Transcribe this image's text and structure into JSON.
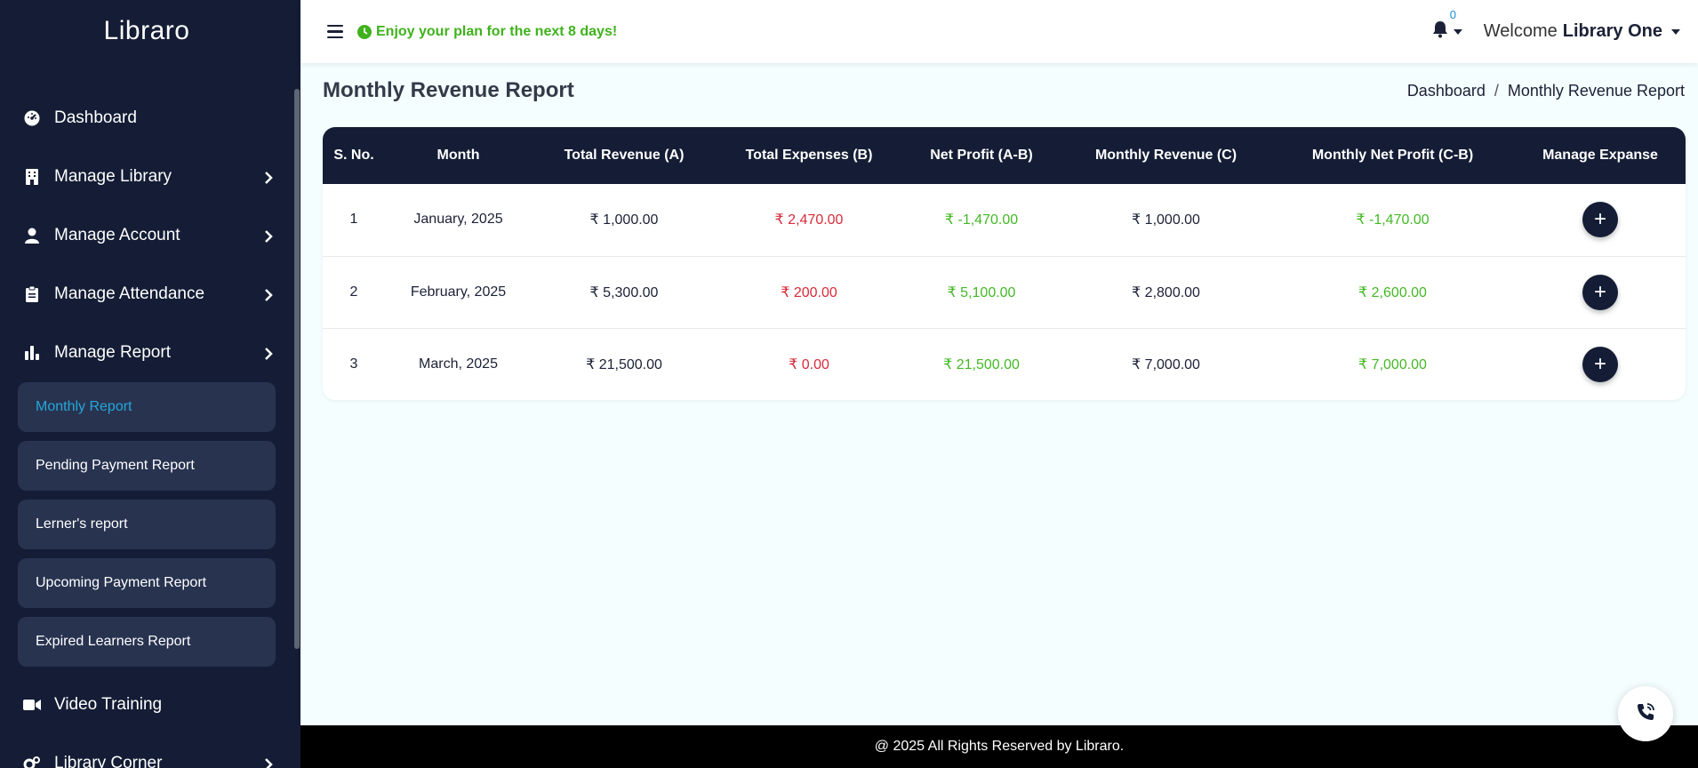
{
  "brand": "Libraro",
  "sidebar": {
    "items": [
      {
        "label": "Dashboard",
        "icon": "dashboard-icon"
      },
      {
        "label": "Manage Library",
        "icon": "building-icon"
      },
      {
        "label": "Manage Account",
        "icon": "user-icon"
      },
      {
        "label": "Manage Attendance",
        "icon": "clipboard-icon"
      },
      {
        "label": "Manage Report",
        "icon": "bar-chart-icon"
      }
    ],
    "sub_items": [
      {
        "label": "Monthly Report",
        "active": true
      },
      {
        "label": "Pending Payment Report"
      },
      {
        "label": "Lerner's report"
      },
      {
        "label": "Upcoming Payment Report"
      },
      {
        "label": "Expired Learners Report"
      }
    ],
    "bottom_items": [
      {
        "label": "Video Training",
        "icon": "video-icon"
      },
      {
        "label": "Library Corner",
        "icon": "gears-icon"
      }
    ]
  },
  "header": {
    "plan_notice": "Enjoy your plan for the next 8 days!",
    "notification_count": "0",
    "welcome_prefix": "Welcome",
    "user_name": "Library One"
  },
  "page": {
    "title": "Monthly Revenue Report",
    "breadcrumb": [
      "Dashboard",
      "/",
      "Monthly Revenue Report"
    ]
  },
  "table": {
    "headers": [
      "S. No.",
      "Month",
      "Total Revenue (A)",
      "Total Expenses (B)",
      "Net Profit (A-B)",
      "Monthly Revenue (C)",
      "Monthly Net Profit (C-B)",
      "Manage Expanse"
    ],
    "rows": [
      {
        "sno": "1",
        "month": "January, 2025",
        "total_revenue": "₹ 1,000.00",
        "total_expenses": "₹ 2,470.00",
        "net_profit": "₹ -1,470.00",
        "monthly_revenue": "₹ 1,000.00",
        "monthly_net_profit": "₹ -1,470.00"
      },
      {
        "sno": "2",
        "month": "February, 2025",
        "total_revenue": "₹ 5,300.00",
        "total_expenses": "₹ 200.00",
        "net_profit": "₹ 5,100.00",
        "monthly_revenue": "₹ 2,800.00",
        "monthly_net_profit": "₹ 2,600.00"
      },
      {
        "sno": "3",
        "month": "March, 2025",
        "total_revenue": "₹ 21,500.00",
        "total_expenses": "₹ 0.00",
        "net_profit": "₹ 21,500.00",
        "monthly_revenue": "₹ 7,000.00",
        "monthly_net_profit": "₹ 7,000.00"
      }
    ],
    "action_label": "+"
  },
  "footer": {
    "text": "@ 2025 All Rights Reserved by Libraro."
  },
  "colors": {
    "sidebar_bg": "#141d35",
    "accent_green": "#43b925",
    "accent_red": "#d72b3a",
    "active_link": "#25a7d9"
  }
}
